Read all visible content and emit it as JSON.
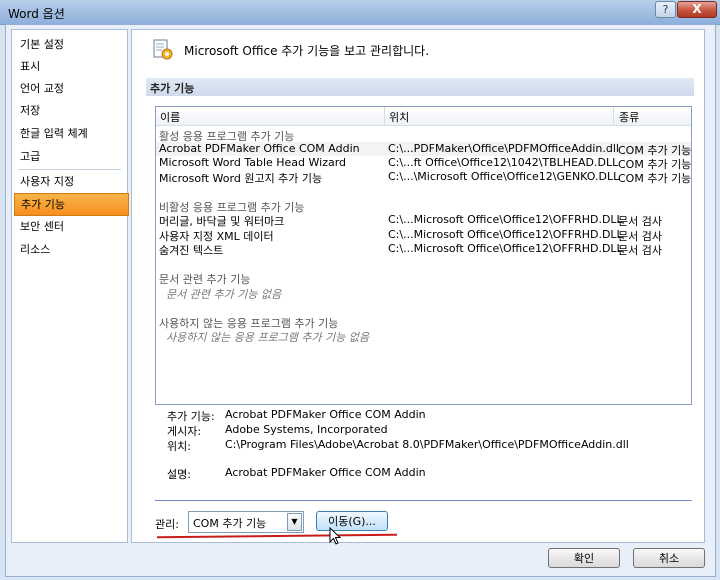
{
  "window": {
    "title": "Word 옵션",
    "help_label": "?",
    "close_label": "X"
  },
  "nav": {
    "items": [
      {
        "label": "기본 설정"
      },
      {
        "label": "표시"
      },
      {
        "label": "언어 교정"
      },
      {
        "label": "저장"
      },
      {
        "label": "한글 입력 체계"
      },
      {
        "label": "고급"
      },
      {
        "label": "사용자 지정"
      },
      {
        "label": "추가 기능",
        "active": true
      },
      {
        "label": "보안 센터"
      },
      {
        "label": "리소스"
      }
    ]
  },
  "header": {
    "text": "Microsoft Office 추가 기능을 보고 관리합니다."
  },
  "section": {
    "title": "추가 기능"
  },
  "table": {
    "columns": [
      "이름",
      "위치",
      "종류"
    ],
    "groups": {
      "active": "활성 응용 프로그램 추가 기능",
      "inactive": "비활성 응용 프로그램 추가 기능",
      "document": "문서 관련 추가 기능",
      "disabled": "사용하지 않는 응용 프로그램 추가 기능"
    },
    "active_rows": [
      [
        "Acrobat PDFMaker Office COM Addin",
        "C:\\...PDFMaker\\Office\\PDFMOfficeAddin.dll",
        "COM 추가 기능"
      ],
      [
        "Microsoft Word Table Head Wizard",
        "C:\\...ft Office\\Office12\\1042\\TBLHEAD.DLL",
        "COM 추가 기능"
      ],
      [
        "Microsoft Word 원고지 추가 기능",
        "C:\\...\\Microsoft Office\\Office12\\GENKO.DLL",
        "COM 추가 기능"
      ]
    ],
    "inactive_rows": [
      [
        "머리글, 바닥글 및 워터마크",
        "C:\\...Microsoft Office\\Office12\\OFFRHD.DLL",
        "문서 검사"
      ],
      [
        "사용자 지정 XML 데이터",
        "C:\\...Microsoft Office\\Office12\\OFFRHD.DLL",
        "문서 검사"
      ],
      [
        "숨겨진 텍스트",
        "C:\\...Microsoft Office\\Office12\\OFFRHD.DLL",
        "문서 검사"
      ]
    ],
    "document_empty": "문서 관련 추가 기능 없음",
    "disabled_empty": "사용하지 않는 응용 프로그램 추가 기능 없음"
  },
  "details": {
    "addin_label": "추가 기능:",
    "addin_value": "Acrobat PDFMaker Office COM Addin",
    "publisher_label": "게시자:",
    "publisher_value": "Adobe Systems, Incorporated",
    "location_label": "위치:",
    "location_value": "C:\\Program Files\\Adobe\\Acrobat 8.0\\PDFMaker\\Office\\PDFMOfficeAddin.dll",
    "description_label": "설명:",
    "description_value": "Acrobat PDFMaker Office COM Addin"
  },
  "manage": {
    "label": "관리:",
    "selected": "COM 추가 기능",
    "go_label": "이동(G)..."
  },
  "footer": {
    "ok_label": "확인",
    "cancel_label": "취소"
  },
  "colors": {
    "accent_orange": "#f58f1f",
    "red_underline": "#c81b1b",
    "title_blue": "#9fbbe0"
  }
}
